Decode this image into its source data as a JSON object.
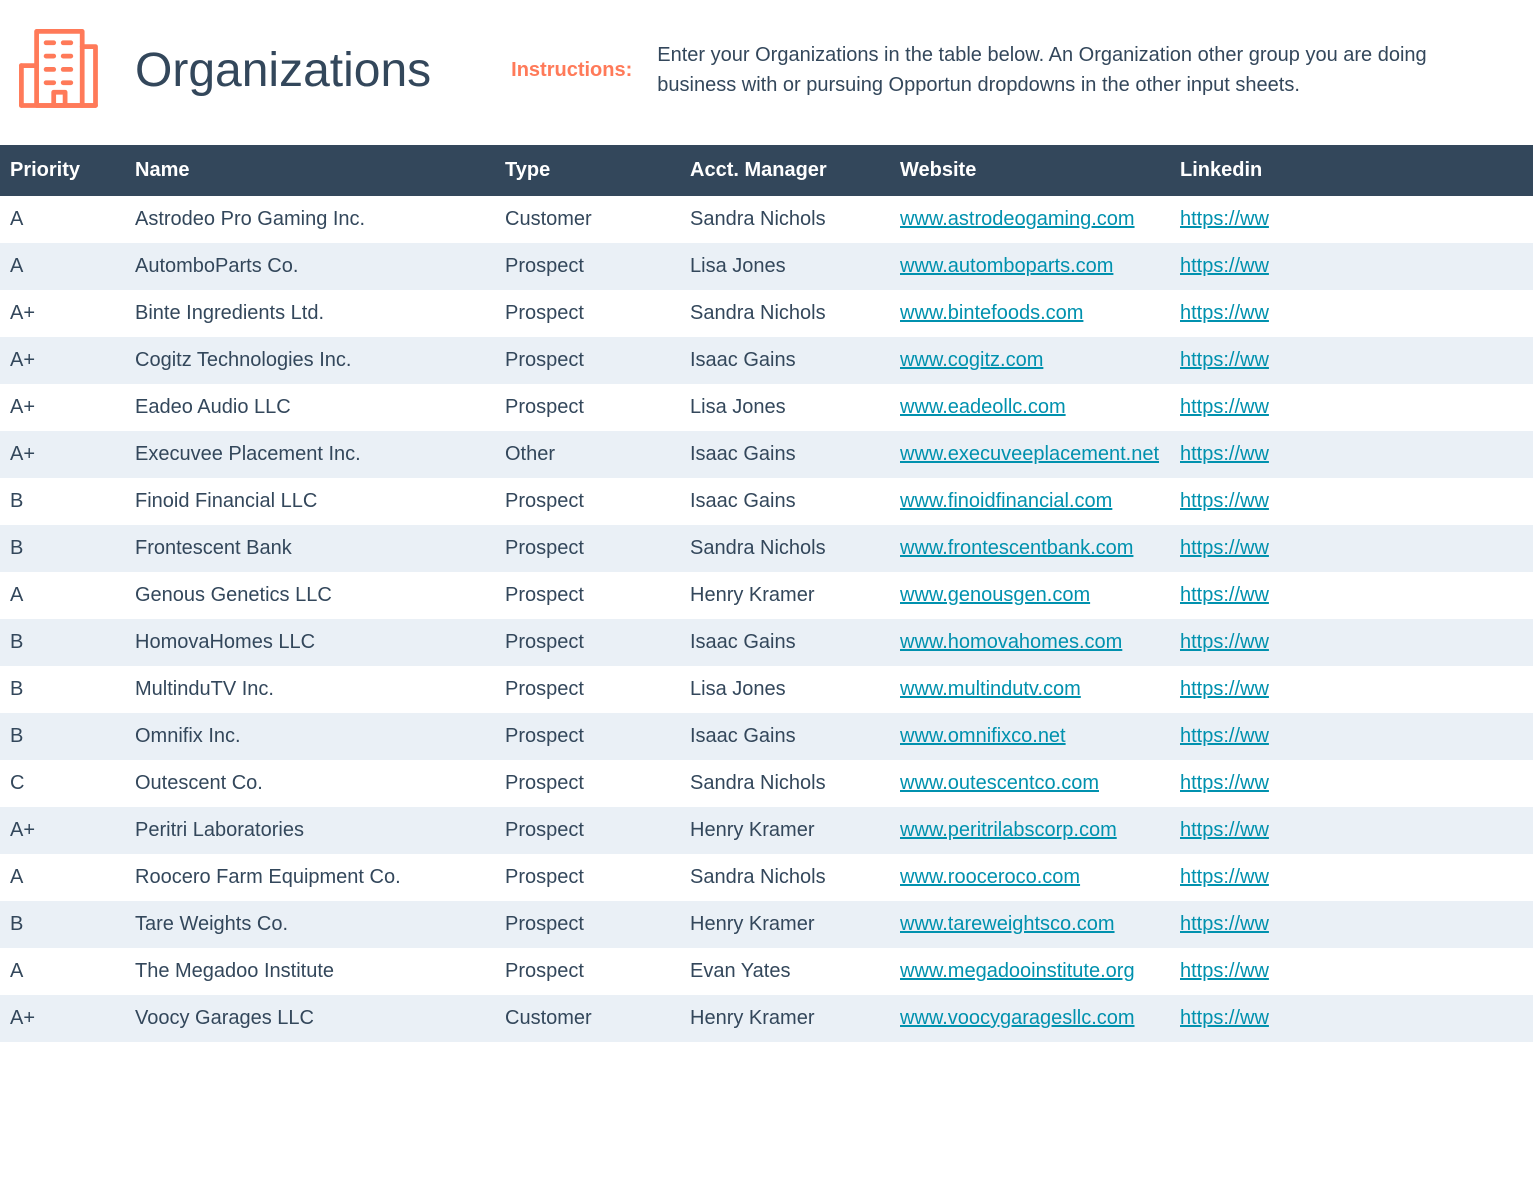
{
  "header": {
    "title": "Organizations",
    "instructions_label": "Instructions:",
    "instructions_text": "Enter your Organizations in the table below. An Organization other group you are doing business with or pursuing Opportun dropdowns in the other input sheets."
  },
  "columns": {
    "priority": "Priority",
    "name": "Name",
    "type": "Type",
    "manager": "Acct. Manager",
    "website": "Website",
    "linkedin": "Linkedin"
  },
  "rows": [
    {
      "priority": "A",
      "name": "Astrodeo Pro Gaming Inc.",
      "type": "Customer",
      "manager": "Sandra Nichols",
      "website": "www.astrodeogaming.com",
      "linkedin": "https://ww"
    },
    {
      "priority": "A",
      "name": "AutomboParts Co.",
      "type": "Prospect",
      "manager": "Lisa Jones",
      "website": "www.automboparts.com",
      "linkedin": "https://ww"
    },
    {
      "priority": "A+",
      "name": "Binte Ingredients Ltd.",
      "type": "Prospect",
      "manager": "Sandra Nichols",
      "website": "www.bintefoods.com",
      "linkedin": "https://ww"
    },
    {
      "priority": "A+",
      "name": "Cogitz Technologies Inc.",
      "type": "Prospect",
      "manager": "Isaac Gains",
      "website": "www.cogitz.com",
      "linkedin": "https://ww"
    },
    {
      "priority": "A+",
      "name": "Eadeo Audio LLC",
      "type": "Prospect",
      "manager": "Lisa Jones",
      "website": "www.eadeollc.com",
      "linkedin": "https://ww"
    },
    {
      "priority": "A+",
      "name": "Execuvee Placement Inc.",
      "type": "Other",
      "manager": "Isaac Gains",
      "website": "www.execuveeplacement.net",
      "linkedin": "https://ww"
    },
    {
      "priority": "B",
      "name": "Finoid Financial LLC",
      "type": "Prospect",
      "manager": "Isaac Gains",
      "website": "www.finoidfinancial.com",
      "linkedin": "https://ww"
    },
    {
      "priority": "B",
      "name": "Frontescent Bank",
      "type": "Prospect",
      "manager": "Sandra Nichols",
      "website": "www.frontescentbank.com",
      "linkedin": "https://ww"
    },
    {
      "priority": "A",
      "name": "Genous Genetics LLC",
      "type": "Prospect",
      "manager": "Henry Kramer",
      "website": "www.genousgen.com",
      "linkedin": "https://ww"
    },
    {
      "priority": "B",
      "name": "HomovaHomes LLC",
      "type": "Prospect",
      "manager": "Isaac Gains",
      "website": "www.homovahomes.com",
      "linkedin": "https://ww"
    },
    {
      "priority": "B",
      "name": "MultinduTV Inc.",
      "type": "Prospect",
      "manager": "Lisa Jones",
      "website": "www.multindutv.com",
      "linkedin": "https://ww"
    },
    {
      "priority": "B",
      "name": "Omnifix Inc.",
      "type": "Prospect",
      "manager": "Isaac Gains",
      "website": "www.omnifixco.net",
      "linkedin": "https://ww"
    },
    {
      "priority": "C",
      "name": "Outescent Co.",
      "type": "Prospect",
      "manager": "Sandra Nichols",
      "website": "www.outescentco.com",
      "linkedin": "https://ww"
    },
    {
      "priority": "A+",
      "name": "Peritri Laboratories",
      "type": "Prospect",
      "manager": "Henry Kramer",
      "website": "www.peritrilabscorp.com",
      "linkedin": "https://ww"
    },
    {
      "priority": "A",
      "name": "Roocero Farm Equipment Co.",
      "type": "Prospect",
      "manager": "Sandra Nichols",
      "website": "www.rooceroco.com",
      "linkedin": "https://ww"
    },
    {
      "priority": "B",
      "name": "Tare Weights Co.",
      "type": "Prospect",
      "manager": "Henry Kramer",
      "website": "www.tareweightsco.com",
      "linkedin": "https://ww"
    },
    {
      "priority": "A",
      "name": "The Megadoo Institute",
      "type": "Prospect",
      "manager": "Evan Yates",
      "website": "www.megadooinstitute.org",
      "linkedin": "https://ww"
    },
    {
      "priority": "A+",
      "name": "Voocy Garages LLC",
      "type": "Customer",
      "manager": "Henry Kramer",
      "website": "www.voocygaragesllc.com",
      "linkedin": "https://ww"
    }
  ]
}
